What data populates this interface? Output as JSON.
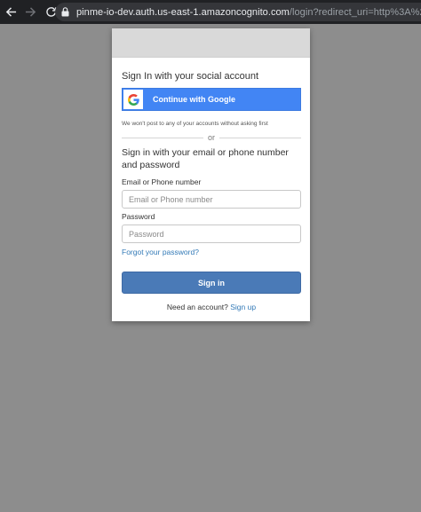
{
  "browser": {
    "url_host": "pinme-io-dev.auth.us-east-1.amazoncognito.com",
    "url_path": "/login?redirect_uri=http%3A%2F%2Flocalho"
  },
  "social": {
    "heading": "Sign In with your social account",
    "google_button_label": "Continue with Google",
    "privacy_note": "We won't post to any of your accounts without asking first"
  },
  "divider": {
    "text": "or"
  },
  "form": {
    "heading": "Sign in with your email or phone number and password",
    "email_label": "Email or Phone number",
    "email_placeholder": "Email or Phone number",
    "password_label": "Password",
    "password_placeholder": "Password",
    "forgot_link": "Forgot your password?",
    "signin_button": "Sign in",
    "signup_prompt": "Need an account?",
    "signup_link": "Sign up"
  },
  "icons": [
    "back-arrow-icon",
    "forward-arrow-icon",
    "reload-icon",
    "lock-icon",
    "google-logo-icon"
  ],
  "colors": {
    "page_background": "#8d8d8d",
    "google_blue": "#4285f4",
    "signin_button": "#4a7ab7",
    "link": "#337ab7"
  }
}
